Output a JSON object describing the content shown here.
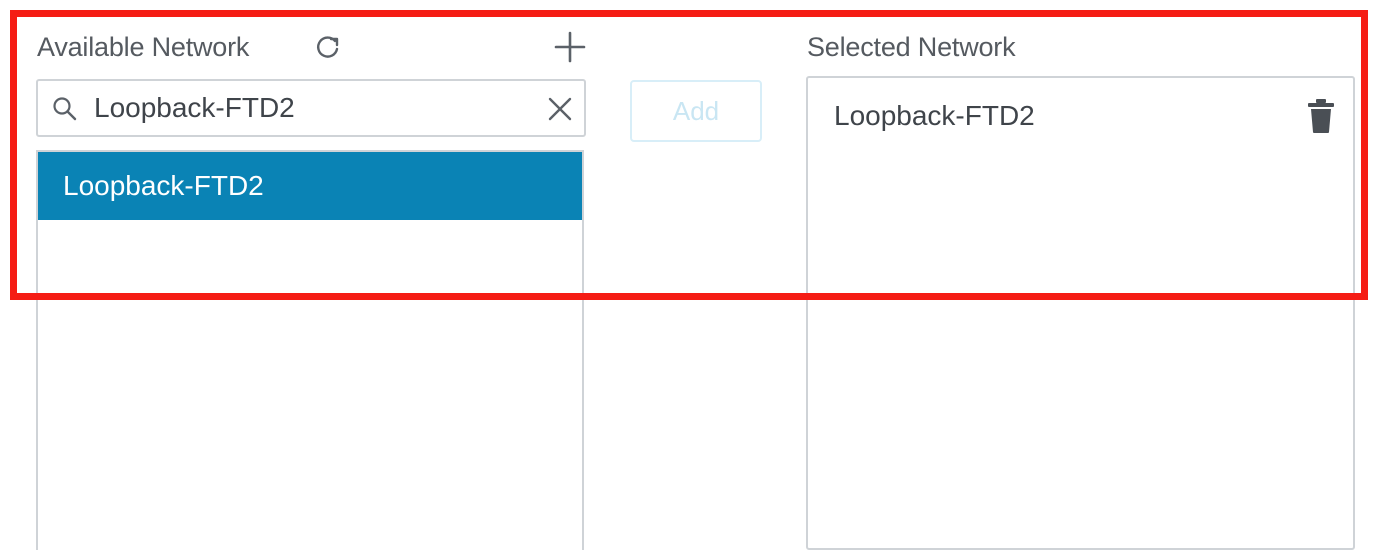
{
  "available": {
    "title": "Available Network",
    "refresh_icon": "refresh-icon",
    "add_icon": "plus-icon",
    "search": {
      "value": "Loopback-FTD2",
      "placeholder": "",
      "icon": "search-icon",
      "clear_icon": "close-icon"
    },
    "items": [
      {
        "label": "Loopback-FTD2",
        "selected": true
      }
    ]
  },
  "add_button": {
    "label": "Add",
    "enabled": false
  },
  "selected": {
    "title": "Selected Network",
    "items": [
      {
        "label": "Loopback-FTD2",
        "delete_icon": "trash-icon"
      }
    ]
  },
  "colors": {
    "selected_row": "#0a83b5",
    "highlight": "#f51d14",
    "border": "#cfd3d7",
    "disabled_button_text": "#c9e6f3"
  }
}
